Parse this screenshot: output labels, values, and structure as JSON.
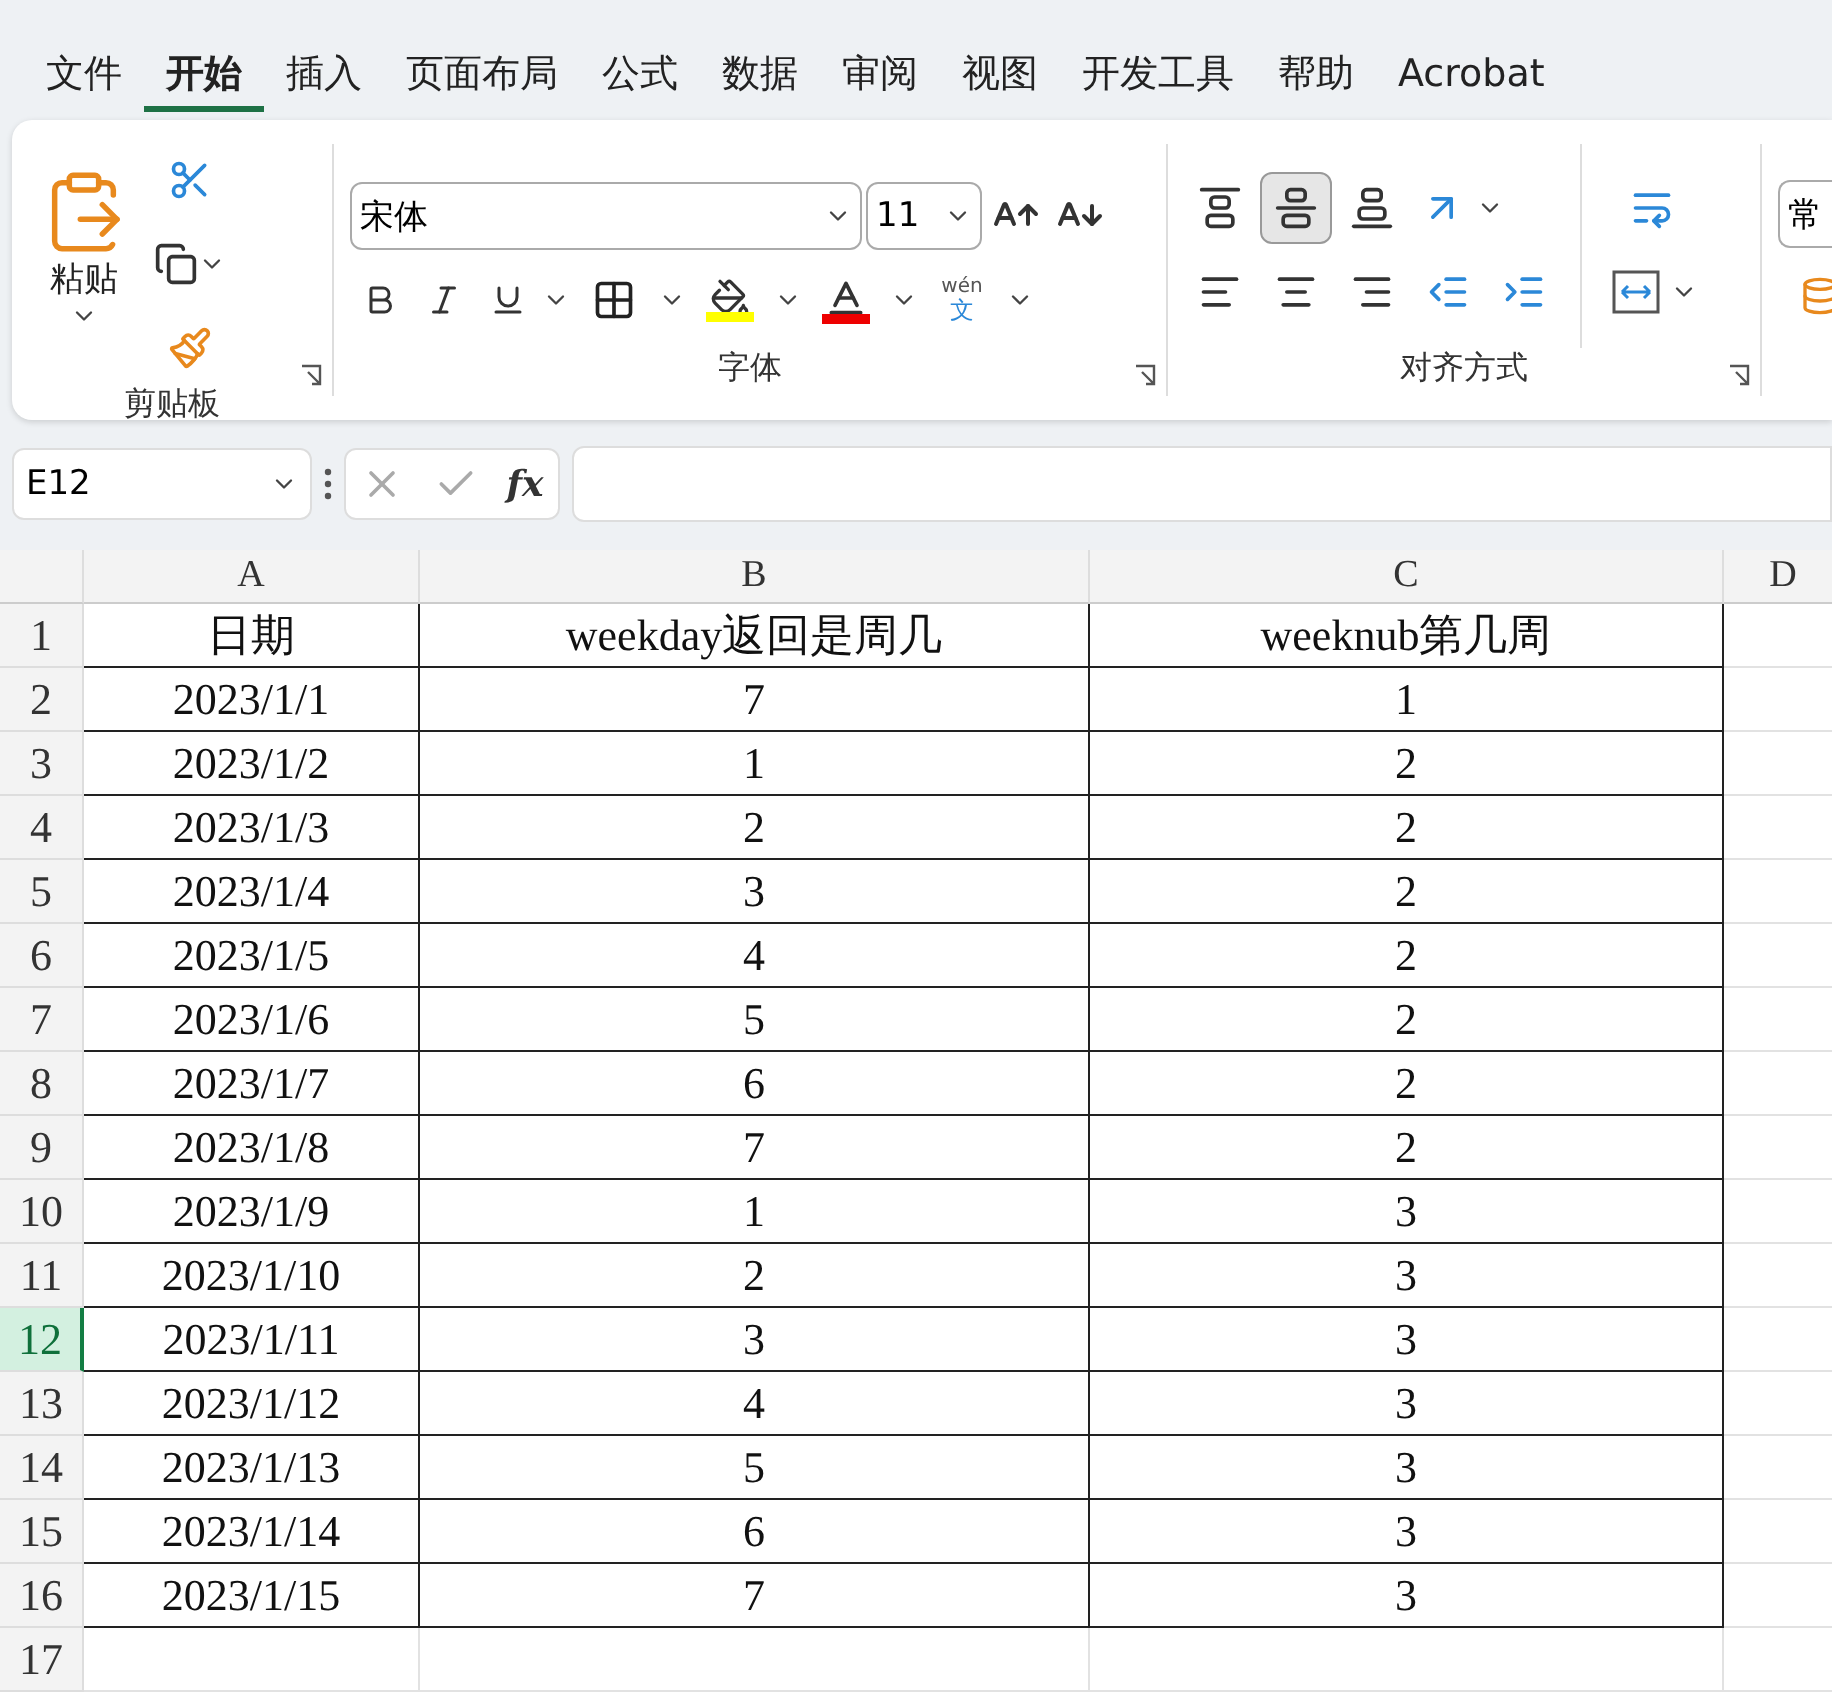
{
  "menu_tabs": [
    {
      "label": "文件",
      "selected": false
    },
    {
      "label": "开始",
      "selected": true
    },
    {
      "label": "插入",
      "selected": false
    },
    {
      "label": "页面布局",
      "selected": false
    },
    {
      "label": "公式",
      "selected": false
    },
    {
      "label": "数据",
      "selected": false
    },
    {
      "label": "审阅",
      "selected": false
    },
    {
      "label": "视图",
      "selected": false
    },
    {
      "label": "开发工具",
      "selected": false
    },
    {
      "label": "帮助",
      "selected": false
    },
    {
      "label": "Acrobat",
      "selected": false
    }
  ],
  "ribbon": {
    "clipboard": {
      "paste_label": "粘贴",
      "title": "剪贴板"
    },
    "font": {
      "font_name": "宋体",
      "font_size": "11",
      "phonetic_top": "wén",
      "phonetic_bottom": "文",
      "title": "字体"
    },
    "alignment": {
      "vertical": [
        {
          "selected": false
        },
        {
          "selected": true
        },
        {
          "selected": false
        }
      ],
      "title": "对齐方式"
    },
    "number": {
      "format": "常"
    }
  },
  "formula_bar": {
    "name_box": "E12",
    "function_label": "fx"
  },
  "columns": [
    "A",
    "B",
    "C",
    "D"
  ],
  "rows": [
    {
      "header": "1",
      "selected": false,
      "cells": [
        "日期",
        "weekday返回是周几",
        "weeknub第几周"
      ]
    },
    {
      "header": "2",
      "selected": false,
      "cells": [
        "2023/1/1",
        "7",
        "1"
      ]
    },
    {
      "header": "3",
      "selected": false,
      "cells": [
        "2023/1/2",
        "1",
        "2"
      ]
    },
    {
      "header": "4",
      "selected": false,
      "cells": [
        "2023/1/3",
        "2",
        "2"
      ]
    },
    {
      "header": "5",
      "selected": false,
      "cells": [
        "2023/1/4",
        "3",
        "2"
      ]
    },
    {
      "header": "6",
      "selected": false,
      "cells": [
        "2023/1/5",
        "4",
        "2"
      ]
    },
    {
      "header": "7",
      "selected": false,
      "cells": [
        "2023/1/6",
        "5",
        "2"
      ]
    },
    {
      "header": "8",
      "selected": false,
      "cells": [
        "2023/1/7",
        "6",
        "2"
      ]
    },
    {
      "header": "9",
      "selected": false,
      "cells": [
        "2023/1/8",
        "7",
        "2"
      ]
    },
    {
      "header": "10",
      "selected": false,
      "cells": [
        "2023/1/9",
        "1",
        "3"
      ]
    },
    {
      "header": "11",
      "selected": false,
      "cells": [
        "2023/1/10",
        "2",
        "3"
      ]
    },
    {
      "header": "12",
      "selected": true,
      "cells": [
        "2023/1/11",
        "3",
        "3"
      ]
    },
    {
      "header": "13",
      "selected": false,
      "cells": [
        "2023/1/12",
        "4",
        "3"
      ]
    },
    {
      "header": "14",
      "selected": false,
      "cells": [
        "2023/1/13",
        "5",
        "3"
      ]
    },
    {
      "header": "15",
      "selected": false,
      "cells": [
        "2023/1/14",
        "6",
        "3"
      ]
    },
    {
      "header": "16",
      "selected": false,
      "cells": [
        "2023/1/15",
        "7",
        "3"
      ]
    },
    {
      "header": "17",
      "selected": false,
      "cells": []
    }
  ]
}
